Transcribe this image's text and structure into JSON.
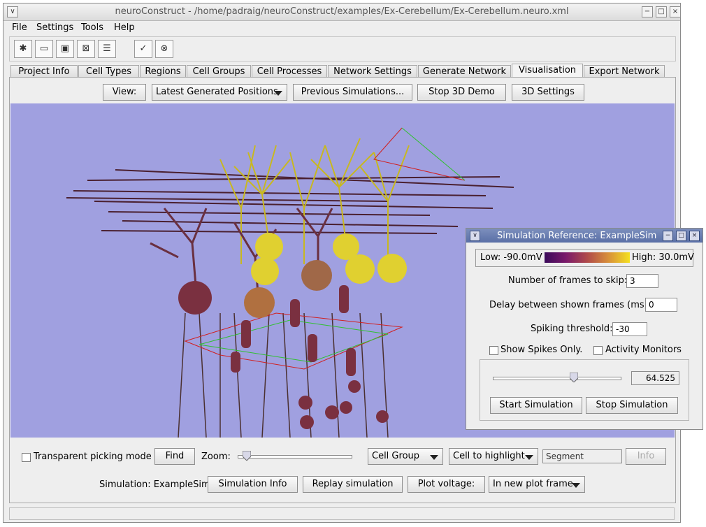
{
  "window": {
    "title": "neuroConstruct - /home/padraig/neuroConstruct/examples/Ex-Cerebellum/Ex-Cerebellum.neuro.xml"
  },
  "menu": [
    "File",
    "Settings",
    "Tools",
    "Help"
  ],
  "toolbar": {
    "icons": [
      "new-project-icon",
      "open-project-icon",
      "save-project-icon",
      "close-project-icon",
      "preferences-icon",
      "validity-check-icon",
      "exit-icon"
    ]
  },
  "tabs": [
    "Project Info",
    "Cell Types",
    "Regions",
    "Cell Groups",
    "Cell Processes",
    "Network Settings",
    "Generate Network",
    "Visualisation",
    "Export Network"
  ],
  "active_tab": "Visualisation",
  "view_bar": {
    "view_label": "View:",
    "view_select": "Latest Generated Positions",
    "prev_sims": "Previous Simulations...",
    "stop_demo": "Stop 3D Demo",
    "settings": "3D Settings"
  },
  "bottom": {
    "picking_label": "Transparent picking mode",
    "find": "Find",
    "zoom_label": "Zoom:",
    "zoom_value": 0.08,
    "cell_group": "Cell Group",
    "highlight": "Cell to highlight",
    "segment_placeholder": "Segment",
    "info": "Info",
    "sim_label": "Simulation: ExampleSim",
    "sim_info": "Simulation Info",
    "replay": "Replay simulation",
    "plot_voltage": "Plot voltage:",
    "plot_target": "In new plot frame"
  },
  "sim_window": {
    "title": "Simulation Reference: ExampleSim",
    "low_label": "Low: -90.0mV",
    "high_label": "High: 30.0mV",
    "colormap": [
      "#3a0a5a",
      "#7a1a6a",
      "#b04a4a",
      "#d8903a",
      "#f4e020"
    ],
    "frames_skip_label": "Number of frames to skip:",
    "frames_skip_value": "3",
    "delay_label": "Delay between shown frames (ms):",
    "delay_value": "0",
    "threshold_label": "Spiking threshold:",
    "threshold_value": "-30",
    "show_spikes": "Show Spikes Only.",
    "activity_monitors": "Activity Monitors",
    "time_value": "64.525",
    "time_fraction": 0.64,
    "start": "Start Simulation",
    "stop": "Stop Simulation"
  }
}
